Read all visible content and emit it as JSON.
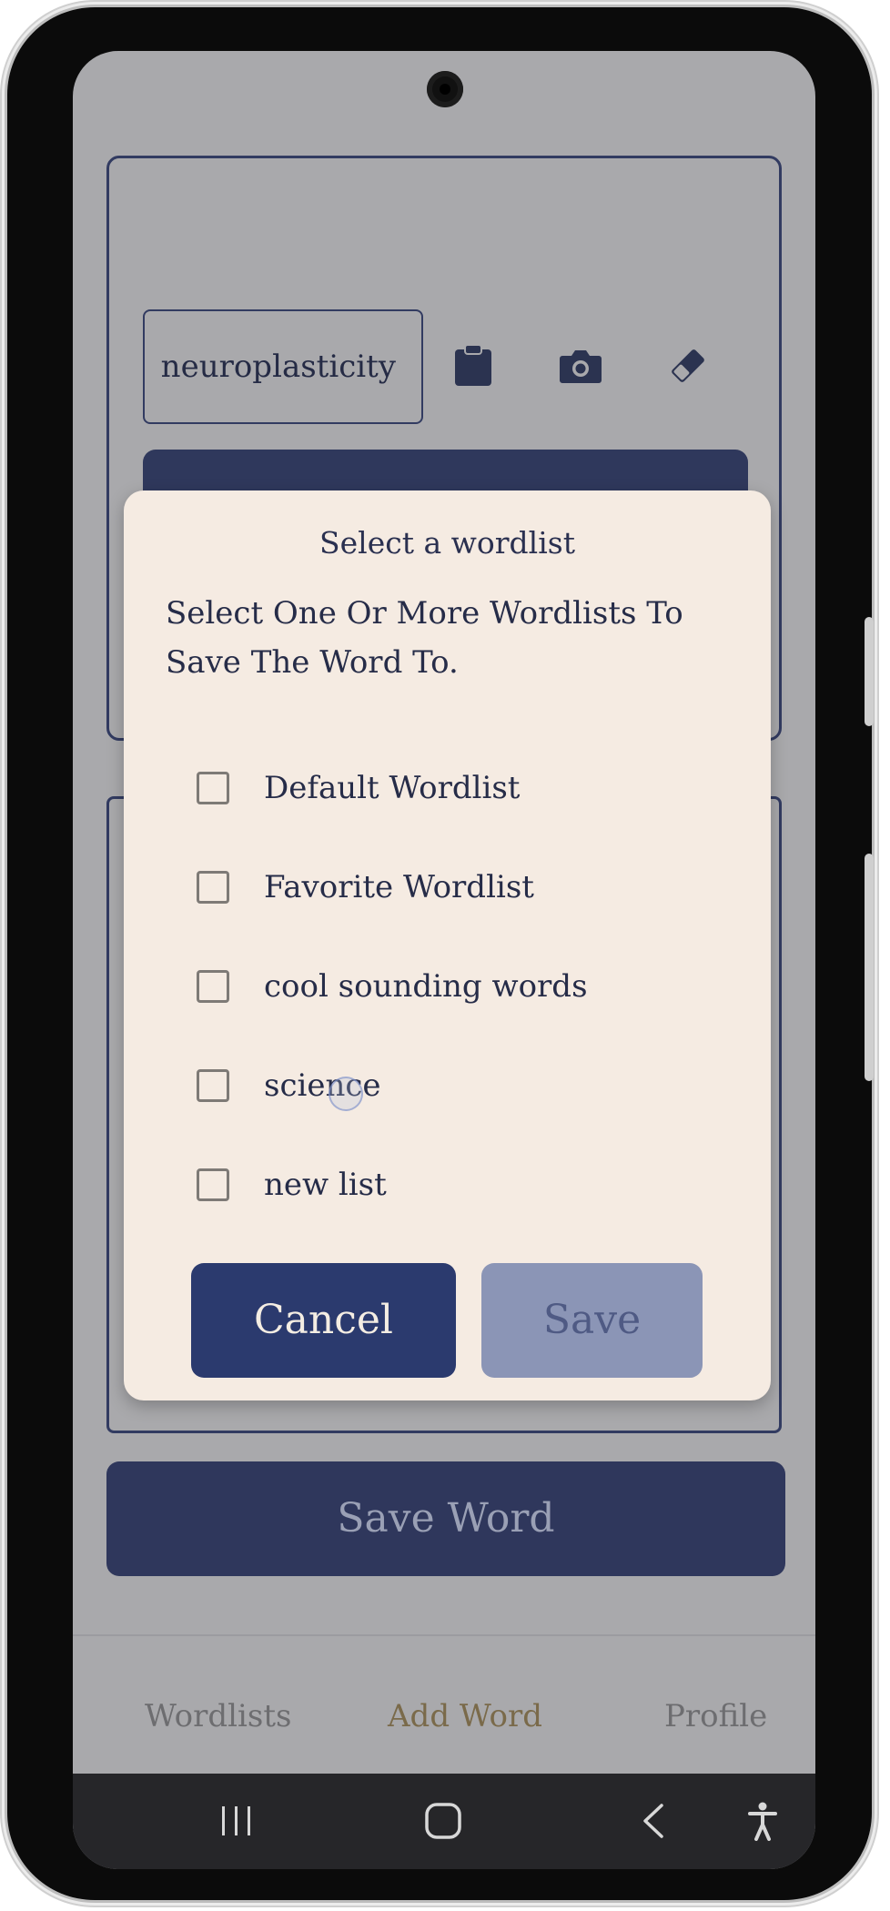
{
  "app": {
    "word_input": {
      "value": "neuroplasticity"
    },
    "tools": {
      "paste_icon": "clipboard-icon",
      "camera_icon": "camera-icon",
      "clear_icon": "eraser-icon"
    },
    "save_word_label": "Save Word",
    "bottom_nav": {
      "items": [
        {
          "label": "Wordlists"
        },
        {
          "label": "Add Word",
          "active": true
        },
        {
          "label": "Profile"
        }
      ]
    }
  },
  "dialog": {
    "title": "Select a wordlist",
    "description": "Select One Or More Wordlists To Save The Word To.",
    "options": [
      {
        "label": "Default Wordlist",
        "checked": false
      },
      {
        "label": "Favorite Wordlist",
        "checked": false
      },
      {
        "label": "cool sounding words",
        "checked": false
      },
      {
        "label": "science",
        "checked": false
      },
      {
        "label": "new list",
        "checked": false
      }
    ],
    "cancel_label": "Cancel",
    "save_label": "Save"
  },
  "system_nav": {
    "recents_icon": "recents-icon",
    "home_icon": "home-icon",
    "back_icon": "back-icon",
    "accessibility_icon": "accessibility-icon"
  },
  "colors": {
    "primary": "#2b3a6e",
    "dialog_bg": "#f5ebe2",
    "scrim": "#a9a9ac",
    "active_tab": "#7a6a4a"
  }
}
